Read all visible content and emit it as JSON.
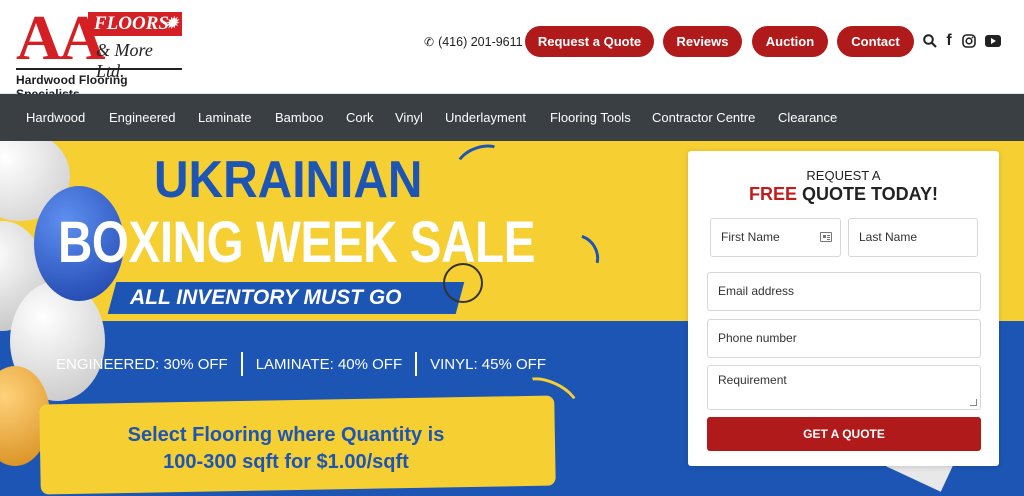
{
  "header": {
    "logo": {
      "aa": "AA",
      "floors": "FLOORS",
      "more": "& More Ltd.",
      "tagline": "Hardwood Flooring Specialists"
    },
    "phone": "(416) 201-9611",
    "buttons": {
      "request_quote": "Request a Quote",
      "reviews": "Reviews",
      "auction": "Auction",
      "contact": "Contact"
    },
    "icons": [
      "search-icon",
      "facebook-icon",
      "instagram-icon",
      "youtube-icon"
    ]
  },
  "nav": {
    "items": [
      "Hardwood",
      "Engineered",
      "Laminate",
      "Bamboo",
      "Cork",
      "Vinyl",
      "Underlayment",
      "Flooring Tools",
      "Contractor Centre",
      "Clearance"
    ]
  },
  "hero": {
    "headline_1": "UKRAINIAN",
    "headline_2": "BOXING WEEK SALE",
    "banner": "ALL INVENTORY MUST GO",
    "offers": [
      "ENGINEERED: 30% OFF",
      "LAMINATE: 40% OFF",
      "VINYL: 45% OFF"
    ],
    "promo_line_1": "Select Flooring where Quantity is",
    "promo_line_2": "100-300 sqft for $1.00/sqft"
  },
  "form": {
    "kicker": "REQUEST A",
    "title_highlight": "FREE",
    "title_rest": " QUOTE TODAY!",
    "placeholders": {
      "first_name": "First Name",
      "last_name": "Last Name",
      "email": "Email address",
      "phone": "Phone number",
      "requirement": "Requirement"
    },
    "submit": "GET A QUOTE"
  },
  "colors": {
    "brand_red": "#b01a1a",
    "logo_red": "#d41f25",
    "nav_bg": "#3a3f43",
    "ukraine_yellow": "#f6cf33",
    "ukraine_blue": "#1d55b4"
  }
}
